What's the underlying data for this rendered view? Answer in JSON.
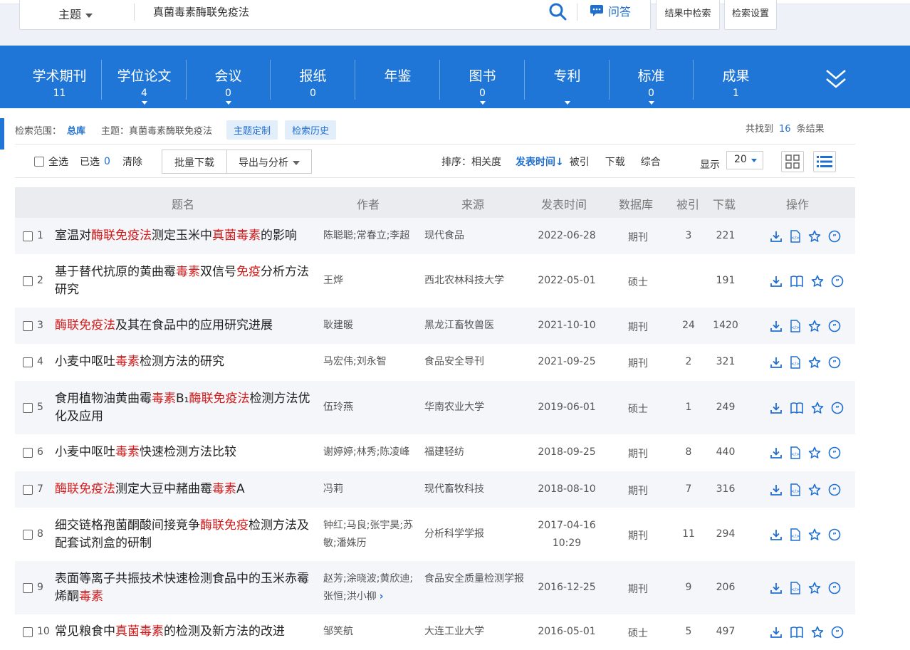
{
  "search": {
    "field": "主题",
    "query": "真菌毒素酶联免疫法",
    "ask_label": "问答",
    "btn_within": "结果中检索",
    "btn_settings": "检索设置"
  },
  "db_tabs": [
    {
      "name": "学术期刊",
      "count": "11"
    },
    {
      "name": "学位论文",
      "count": "4"
    },
    {
      "name": "会议",
      "count": "0"
    },
    {
      "name": "报纸",
      "count": "0"
    },
    {
      "name": "年鉴",
      "count": ""
    },
    {
      "name": "图书",
      "count": "0"
    },
    {
      "name": "专利",
      "count": ""
    },
    {
      "name": "标准",
      "count": "0"
    },
    {
      "name": "成果",
      "count": "1"
    }
  ],
  "scope": {
    "label": "检索范围：",
    "library": "总库",
    "topic": "主题：真菌毒素酶联免疫法",
    "customize": "主题定制",
    "history": "检索历史",
    "found_prefix": "共找到",
    "found_count": "16",
    "found_suffix": "条结果"
  },
  "toolbar": {
    "select_all": "全选",
    "selected_label": "已选",
    "selected_count": "0",
    "clear": "清除",
    "batch_download": "批量下载",
    "export": "导出与分析",
    "sort_label": "排序：",
    "sort_relevance": "相关度",
    "sort_date": "发表时间",
    "sort_cited": "被引",
    "sort_download": "下载",
    "sort_overall": "综合",
    "display_label": "显示",
    "page_size": "20"
  },
  "table": {
    "headers": {
      "title": "题名",
      "author": "作者",
      "source": "来源",
      "date": "发表时间",
      "db": "数据库",
      "cited": "被引",
      "download": "下载",
      "ops": "操作"
    },
    "rows": [
      {
        "idx": "1",
        "title": [
          [
            "室温对",
            0
          ],
          [
            "酶联免疫法",
            1
          ],
          [
            "测定玉米中",
            0
          ],
          [
            "真菌毒素",
            1
          ],
          [
            "的影响",
            0
          ]
        ],
        "author": "陈聪聪;常春立;李超",
        "source": "现代食品",
        "date": "2022-06-28",
        "db": "期刊",
        "cited": "3",
        "download": "221"
      },
      {
        "idx": "2",
        "title": [
          [
            "基于替代抗原的黄曲霉",
            0
          ],
          [
            "毒素",
            1
          ],
          [
            "双信号",
            0
          ],
          [
            "免疫",
            1
          ],
          [
            "分析方法研究",
            0
          ]
        ],
        "author": "王烨",
        "source": "西北农林科技大学",
        "date": "2022-05-01",
        "db": "硕士",
        "cited": "",
        "download": "191"
      },
      {
        "idx": "3",
        "title": [
          [
            "酶联免疫法",
            1
          ],
          [
            "及其在食品中的应用研究进展",
            0
          ]
        ],
        "author": "耿建暖",
        "source": "黑龙江畜牧兽医",
        "date": "2021-10-10",
        "db": "期刊",
        "cited": "24",
        "download": "1420"
      },
      {
        "idx": "4",
        "title": [
          [
            "小麦中呕吐",
            0
          ],
          [
            "毒素",
            1
          ],
          [
            "检测方法的研究",
            0
          ]
        ],
        "author": "马宏伟;刘永智",
        "source": "食品安全导刊",
        "date": "2021-09-25",
        "db": "期刊",
        "cited": "2",
        "download": "321"
      },
      {
        "idx": "5",
        "title": [
          [
            "食用植物油黄曲霉",
            0
          ],
          [
            "毒素",
            1
          ],
          [
            "B₁",
            0
          ],
          [
            "酶联免疫法",
            1
          ],
          [
            "检测方法优化及应用",
            0
          ]
        ],
        "author": "伍玲燕",
        "source": "华南农业大学",
        "date": "2019-06-01",
        "db": "硕士",
        "cited": "1",
        "download": "249"
      },
      {
        "idx": "6",
        "title": [
          [
            "小麦中呕吐",
            0
          ],
          [
            "毒素",
            1
          ],
          [
            "快速检测方法比较",
            0
          ]
        ],
        "author": "谢婷婷;林秀;陈凌峰",
        "source": "福建轻纺",
        "date": "2018-09-25",
        "db": "期刊",
        "cited": "8",
        "download": "440"
      },
      {
        "idx": "7",
        "title": [
          [
            "酶联免疫法",
            1
          ],
          [
            "测定大豆中赭曲霉",
            0
          ],
          [
            "毒素",
            1
          ],
          [
            "A",
            0
          ]
        ],
        "author": "冯莉",
        "source": "现代畜牧科技",
        "date": "2018-08-10",
        "db": "期刊",
        "cited": "7",
        "download": "316"
      },
      {
        "idx": "8",
        "title": [
          [
            "细交链格孢菌酮酸间接竞争",
            0
          ],
          [
            "酶联免疫",
            1
          ],
          [
            "检测方法及配套试剂盒的研制",
            0
          ]
        ],
        "author": "钟红;马良;张宇昊;苏敏;潘姝历",
        "source": "分析科学学报",
        "date": "2017-04-16 10:29",
        "db": "期刊",
        "cited": "11",
        "download": "294"
      },
      {
        "idx": "9",
        "title": [
          [
            "表面等离子共振技术快速检测食品中的玉米赤霉烯酮",
            0
          ],
          [
            "毒素",
            1
          ]
        ],
        "author": "赵芳;涂晓波;黄欣迪;张恒;洪小柳",
        "source": "食品安全质量检测学报",
        "date": "2016-12-25",
        "db": "期刊",
        "cited": "9",
        "download": "206"
      },
      {
        "idx": "10",
        "title": [
          [
            "常见粮食中",
            0
          ],
          [
            "真菌毒素",
            1
          ],
          [
            "的检测及新方法的改进",
            0
          ]
        ],
        "author": "邹笑航",
        "source": "大连工业大学",
        "date": "2016-05-01",
        "db": "硕士",
        "cited": "5",
        "download": "497"
      }
    ]
  },
  "colors": {
    "primary": "#1f76d6",
    "highlight": "#d41a1a",
    "link": "#1f6fd1"
  }
}
